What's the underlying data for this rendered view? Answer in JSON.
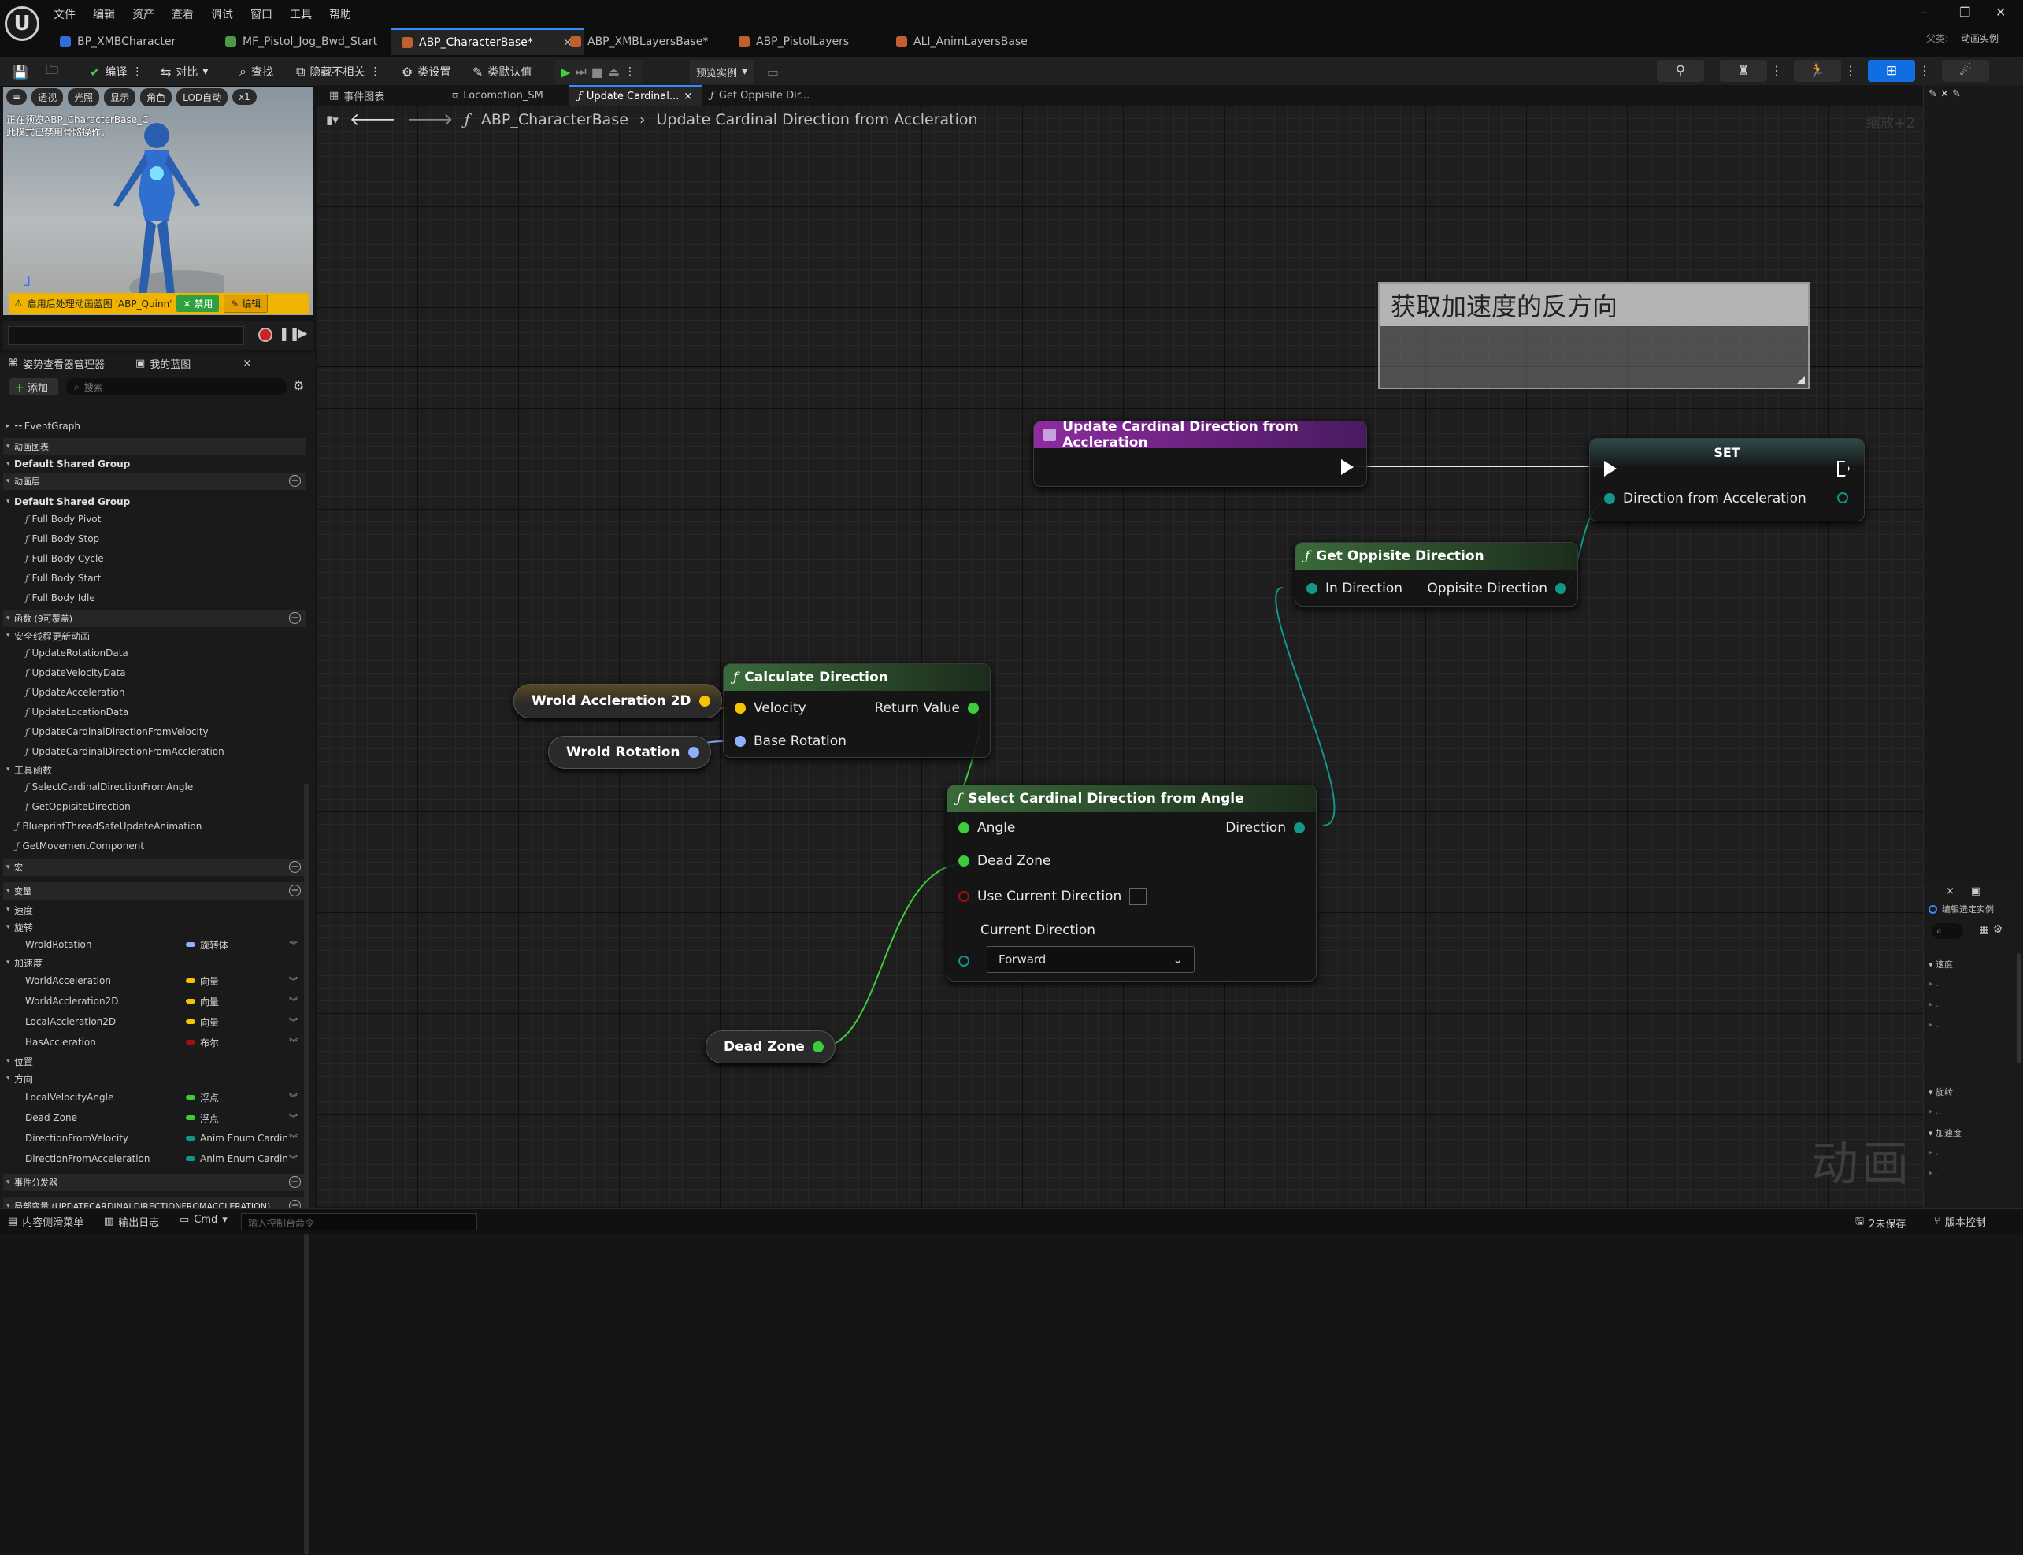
{
  "menu": [
    "文件",
    "编辑",
    "资产",
    "查看",
    "调试",
    "窗口",
    "工具",
    "帮助"
  ],
  "logo_glyph": "U",
  "doc_tabs": [
    {
      "label": "BP_XMBCharacter",
      "color": "#2f6ed8"
    },
    {
      "label": "MF_Pistol_Jog_Bwd_Start",
      "color": "#4a9a4a"
    },
    {
      "label": "ABP_CharacterBase*",
      "color": "#c06030",
      "active": true
    },
    {
      "label": "ABP_XMBLayersBase*",
      "color": "#c06030"
    },
    {
      "label": "ABP_PistolLayers",
      "color": "#c06030"
    },
    {
      "label": "ALI_AnimLayersBase",
      "color": "#c06030"
    }
  ],
  "window": {
    "parent_label": "父类:",
    "parent_value": "动画实例"
  },
  "toolbar": {
    "save_icon": "save-icon",
    "browse_icon": "folder-icon",
    "compile": "编译",
    "diff": "对比",
    "find": "查找",
    "hide": "隐藏不相关",
    "class_settings": "类设置",
    "class_defaults": "类默认值",
    "preview": "预览实例"
  },
  "viewport": {
    "chips": [
      "透视",
      "光照",
      "显示",
      "角色",
      "LOD自动",
      "x1"
    ],
    "info_line1": "正在预览ABP_CharacterBase_C",
    "info_line2": "此模式已禁用骨骼操作。",
    "warning": "启用后处理动画蓝图 'ABP_Quinn'",
    "enable": "禁用",
    "edit": "编辑"
  },
  "left_tabs": {
    "tab1": "姿势查看器管理器",
    "tab2": "我的蓝图"
  },
  "mybp": {
    "add": "添加",
    "search_placeholder": "搜索",
    "rows": [
      {
        "text": "EventGraph",
        "type": "graph"
      },
      {
        "text": "动画图表",
        "type": "head"
      },
      {
        "text": "Default Shared Group",
        "type": "sub"
      },
      {
        "text": "动画层",
        "type": "head",
        "plus": true
      },
      {
        "text": "Default Shared Group",
        "type": "sub"
      },
      {
        "text": "Full Body Pivot",
        "type": "fn"
      },
      {
        "text": "Full Body Stop",
        "type": "fn"
      },
      {
        "text": "Full Body Cycle",
        "type": "fn"
      },
      {
        "text": "Full Body Start",
        "type": "fn"
      },
      {
        "text": "Full Body Idle",
        "type": "fn"
      },
      {
        "text": "函数 (9可覆盖)",
        "type": "head",
        "plus": true
      },
      {
        "text": "安全线程更新动画",
        "type": "cat"
      },
      {
        "text": "UpdateRotationData",
        "type": "fn"
      },
      {
        "text": "UpdateVelocityData",
        "type": "fn"
      },
      {
        "text": "UpdateAcceleration",
        "type": "fn"
      },
      {
        "text": "UpdateLocationData",
        "type": "fn"
      },
      {
        "text": "UpdateCardinalDirectionFromVelocity",
        "type": "fn"
      },
      {
        "text": "UpdateCardinalDirectionFromAccleration",
        "type": "fn"
      },
      {
        "text": "工具函数",
        "type": "cat"
      },
      {
        "text": "SelectCardinalDirectionFromAngle",
        "type": "fn"
      },
      {
        "text": "GetOppisiteDirection",
        "type": "fn"
      },
      {
        "text": "BlueprintThreadSafeUpdateAnimation",
        "type": "fn0"
      },
      {
        "text": "GetMovementComponent",
        "type": "fn0"
      },
      {
        "text": "宏",
        "type": "head",
        "plus": true
      },
      {
        "text": "变量",
        "type": "head",
        "plus": true
      },
      {
        "text": "速度",
        "type": "cat"
      },
      {
        "text": "旋转",
        "type": "cat"
      },
      {
        "text": "WroldRotation",
        "type": "var",
        "vtype": "旋转体",
        "color": "#8fb0ff"
      },
      {
        "text": "加速度",
        "type": "cat"
      },
      {
        "text": "WorldAcceleration",
        "type": "var",
        "vtype": "向量",
        "color": "#f5c400"
      },
      {
        "text": "WorldAccleration2D",
        "type": "var",
        "vtype": "向量",
        "color": "#f5c400"
      },
      {
        "text": "LocalAccleration2D",
        "type": "var",
        "vtype": "向量",
        "color": "#f5c400"
      },
      {
        "text": "HasAccleration",
        "type": "var",
        "vtype": "布尔",
        "color": "#a01010"
      },
      {
        "text": "位置",
        "type": "cat"
      },
      {
        "text": "方向",
        "type": "cat"
      },
      {
        "text": "LocalVelocityAngle",
        "type": "var",
        "vtype": "浮点",
        "color": "#3ccc3c"
      },
      {
        "text": "Dead Zone",
        "type": "var",
        "vtype": "浮点",
        "color": "#3ccc3c"
      },
      {
        "text": "DirectionFromVelocity",
        "type": "var",
        "vtype": "Anim Enum Cardin",
        "color": "#12968a"
      },
      {
        "text": "DirectionFromAcceleration",
        "type": "var",
        "vtype": "Anim Enum Cardin",
        "color": "#12968a"
      },
      {
        "text": "事件分发器",
        "type": "head",
        "plus": true
      },
      {
        "text": "局部变量 (UPDATECARDINALDIRECTIONFROMACCLERATION)",
        "type": "head",
        "plus": true
      }
    ]
  },
  "graph_tabs": [
    {
      "label": "事件图表"
    },
    {
      "label": "Locomotion_SM"
    },
    {
      "label": "Update Cardinal...",
      "active": true
    },
    {
      "label": "Get Oppisite Dir..."
    }
  ],
  "breadcrumb": {
    "root": "ABP_CharacterBase",
    "current": "Update Cardinal Direction from Accleration",
    "zoom": "缩放+2"
  },
  "comment": "获取加速度的反方向",
  "nodes": {
    "entry": {
      "title": "Update Cardinal Direction from Accleration"
    },
    "set": {
      "title": "SET",
      "pin": "Direction from Acceleration"
    },
    "opposite": {
      "title": "Get Oppisite Direction",
      "in": "In Direction",
      "out": "Oppisite Direction"
    },
    "calc": {
      "title": "Calculate Direction",
      "velocity": "Velocity",
      "base": "Base Rotation",
      "ret": "Return Value"
    },
    "select": {
      "title": "Select Cardinal Direction from Angle",
      "angle": "Angle",
      "dead": "Dead Zone",
      "use": "Use Current Direction",
      "current": "Current Direction",
      "dropdown": "Forward",
      "out": "Direction"
    },
    "var_accel": "Wrold Accleration 2D",
    "var_rot": "Wrold Rotation",
    "var_dead": "Dead Zone"
  },
  "watermark": "动画",
  "right": {
    "edit_instance": "编辑选定实例",
    "cat_speed": "速度",
    "cat_rot": "旋转",
    "cat_accel": "加速度"
  },
  "status": {
    "content": "内容侧滑菜单",
    "log": "输出日志",
    "cmd": "Cmd",
    "cmd_placeholder": "输入控制台命令",
    "unsaved": "2未保存",
    "source": "版本控制"
  }
}
